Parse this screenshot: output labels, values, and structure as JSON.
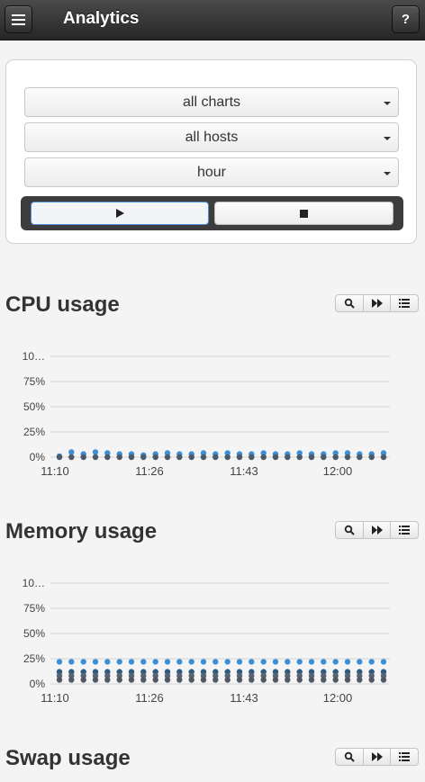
{
  "header": {
    "title": "Analytics",
    "help_label": "?"
  },
  "controls": {
    "chart_select": "all charts",
    "host_select": "all hosts",
    "range_select": "hour"
  },
  "charts": [
    {
      "title": "CPU usage"
    },
    {
      "title": "Memory usage"
    },
    {
      "title": "Swap usage"
    }
  ],
  "colors": {
    "series_light": "#a6cdec",
    "series_mid": "#3c8fd6",
    "series_dark": "#2f5b7f",
    "series_gray": "#4f5a66"
  },
  "chart_data": [
    {
      "type": "scatter",
      "title": "CPU usage",
      "y_ticks": [
        "0%",
        "25%",
        "50%",
        "75%",
        "10…"
      ],
      "x_ticks": [
        "11:10",
        "11:26",
        "11:43",
        "12:00"
      ],
      "ylim": [
        0,
        100
      ],
      "x_range": [
        "11:10",
        "12:05"
      ],
      "grid": true,
      "series": [
        {
          "color": "#a6cdec",
          "values": [
            0,
            0,
            0,
            0,
            0,
            0,
            0,
            0,
            0,
            0,
            0,
            0,
            0,
            0,
            0,
            0,
            0,
            0,
            0,
            0,
            0,
            0,
            0,
            0,
            0,
            0,
            0,
            0
          ]
        },
        {
          "color": "#3c8fd6",
          "values": [
            1,
            5,
            3,
            5,
            4,
            3,
            3,
            2,
            3,
            4,
            3,
            3,
            4,
            3,
            4,
            3,
            3,
            4,
            3,
            3,
            4,
            3,
            3,
            4,
            4,
            3,
            3,
            4
          ]
        },
        {
          "color": "#4f5a66",
          "values": [
            0,
            0,
            0,
            0,
            0,
            0,
            0,
            0,
            0,
            0,
            0,
            0,
            0,
            0,
            0,
            0,
            0,
            0,
            0,
            0,
            0,
            0,
            0,
            0,
            0,
            0,
            0,
            0
          ]
        }
      ]
    },
    {
      "type": "scatter",
      "title": "Memory usage",
      "y_ticks": [
        "0%",
        "25%",
        "50%",
        "75%",
        "10…"
      ],
      "x_ticks": [
        "11:10",
        "11:26",
        "11:43",
        "12:00"
      ],
      "ylim": [
        0,
        100
      ],
      "x_range": [
        "11:10",
        "12:05"
      ],
      "grid": true,
      "series": [
        {
          "color": "#3c8fd6",
          "values": [
            22,
            22,
            22,
            22,
            22,
            22,
            22,
            22,
            22,
            22,
            22,
            22,
            22,
            22,
            22,
            22,
            22,
            22,
            22,
            22,
            22,
            22,
            22,
            22,
            22,
            22,
            22,
            22
          ]
        },
        {
          "color": "#2f5b7f",
          "values": [
            12,
            12,
            12,
            12,
            12,
            12,
            12,
            12,
            12,
            12,
            12,
            12,
            12,
            12,
            12,
            12,
            12,
            12,
            12,
            12,
            12,
            12,
            12,
            12,
            12,
            12,
            12,
            12
          ]
        },
        {
          "color": "#5a6470",
          "values": [
            8,
            8,
            8,
            8,
            8,
            8,
            8,
            8,
            8,
            8,
            8,
            8,
            8,
            8,
            8,
            8,
            8,
            8,
            8,
            8,
            8,
            8,
            8,
            8,
            8,
            8,
            8,
            8
          ]
        },
        {
          "color": "#4f5a66",
          "values": [
            4,
            4,
            4,
            4,
            4,
            4,
            4,
            4,
            4,
            4,
            4,
            4,
            4,
            4,
            4,
            4,
            4,
            4,
            4,
            4,
            4,
            4,
            4,
            4,
            4,
            4,
            4,
            4
          ]
        }
      ]
    }
  ]
}
